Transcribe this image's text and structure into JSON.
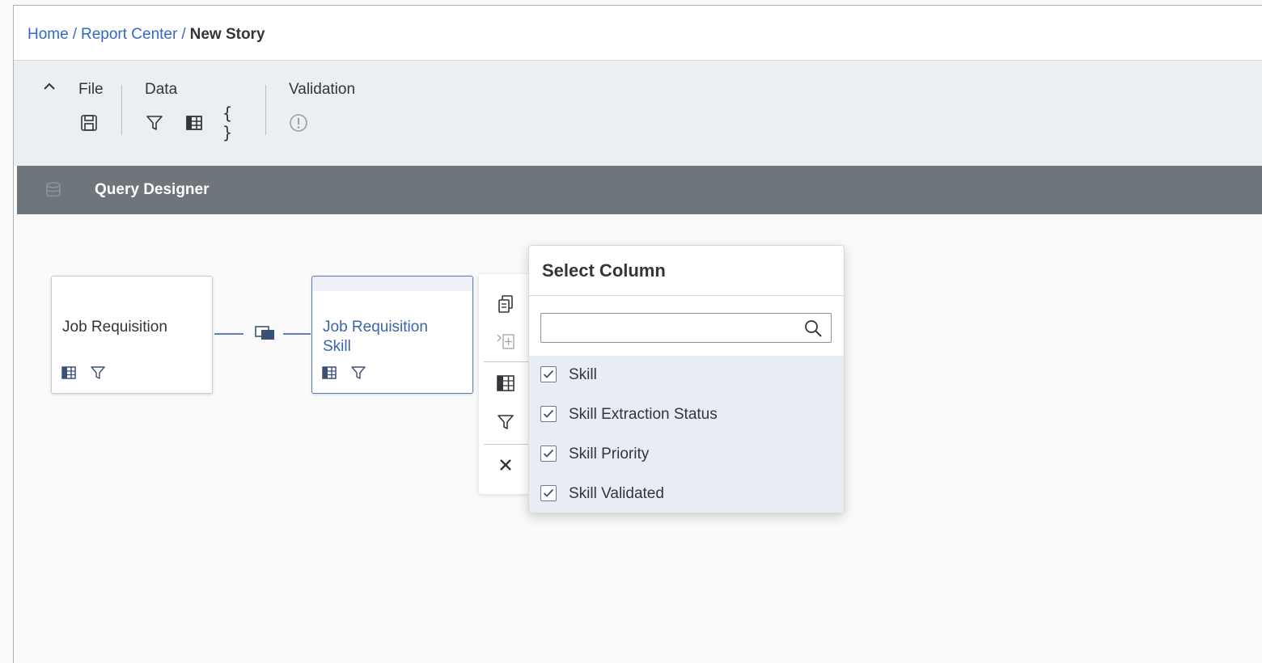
{
  "breadcrumb": {
    "home": "Home",
    "sep1": "/",
    "report_center": "Report Center",
    "sep2": "/",
    "current": "New Story"
  },
  "toolbar": {
    "groups": [
      {
        "label": "File",
        "icons": [
          "save-icon"
        ]
      },
      {
        "label": "Data",
        "icons": [
          "filter-icon",
          "table-columns-icon",
          "braces-icon"
        ]
      },
      {
        "label": "Validation",
        "icons": [
          "exclamation-circle-icon"
        ]
      }
    ],
    "braces_glyph": "{ }"
  },
  "section": {
    "title": "Query Designer",
    "icon": "database-icon"
  },
  "nodes": [
    {
      "title": "Job Requisition",
      "selected": false
    },
    {
      "title_line1": "Job Requisition",
      "title_line2": "Skill",
      "selected": true
    }
  ],
  "side_toolbar": {
    "icons": [
      "copy-icon",
      "add-column-icon",
      "table-columns-icon",
      "filter-icon",
      "close-icon"
    ]
  },
  "select_column": {
    "title": "Select Column",
    "search_value": "",
    "search_placeholder": "",
    "items": [
      {
        "label": "Skill",
        "checked": true
      },
      {
        "label": "Skill Extraction Status",
        "checked": true
      },
      {
        "label": "Skill Priority",
        "checked": true
      },
      {
        "label": "Skill Validated",
        "checked": true
      }
    ]
  },
  "colors": {
    "link": "#3667c8",
    "toolbar_bg": "#eaeff4",
    "section_bar": "#6e767c",
    "accent": "#5b80c0"
  }
}
